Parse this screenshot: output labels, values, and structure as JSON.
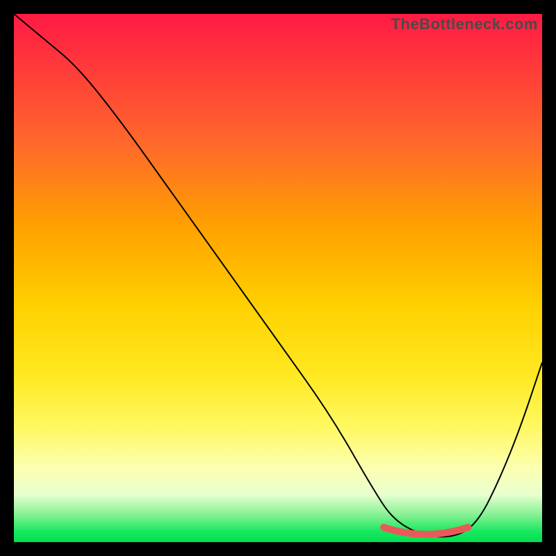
{
  "watermark": "TheBottleneck.com",
  "colors": {
    "frame": "#000000",
    "curve": "#000000",
    "highlight": "#e85a5a"
  },
  "chart_data": {
    "type": "line",
    "title": "",
    "xlabel": "",
    "ylabel": "",
    "xlim": [
      0,
      100
    ],
    "ylim": [
      0,
      100
    ],
    "grid": false,
    "legend": false,
    "background_gradient": [
      "#ff1a44",
      "#ffd000",
      "#fff860",
      "#00e050"
    ],
    "series": [
      {
        "name": "bottleneck-curve",
        "x": [
          0,
          6,
          12,
          20,
          30,
          40,
          50,
          60,
          68,
          72,
          78,
          84,
          88,
          92,
          96,
          100
        ],
        "values": [
          100,
          95,
          90,
          80,
          66,
          52,
          38,
          24,
          10,
          4,
          1,
          1,
          4,
          12,
          22,
          34
        ]
      }
    ],
    "highlight_range": {
      "x_start": 70,
      "x_end": 86,
      "y": 2
    }
  }
}
